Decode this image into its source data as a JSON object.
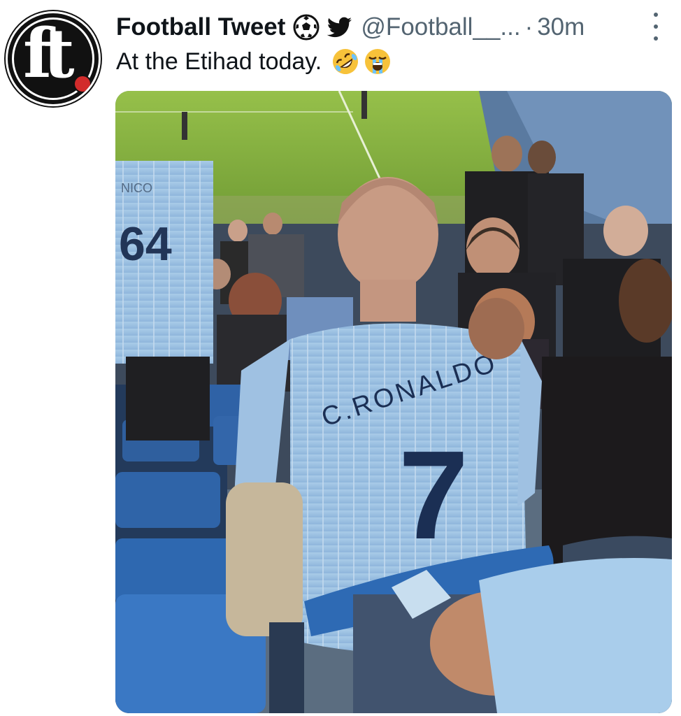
{
  "tweet": {
    "avatar_text": "ft",
    "author_name": "Football Tweet",
    "handle": "@Football__...",
    "separator": "·",
    "time": "30m",
    "text": "At the Etihad today.",
    "text_emojis": [
      "rolling-on-floor-laughing-emoji",
      "loudly-crying-emoji"
    ],
    "name_badges": [
      "soccer-ball-icon",
      "twitter-bird-icon"
    ]
  },
  "photo": {
    "jersey_main_name": "C.RONALDO",
    "jersey_main_number": "7",
    "jersey_left_name": "NICO",
    "jersey_left_number": "64"
  },
  "colors": {
    "name": "#0f1419",
    "secondary": "#536471",
    "city_blue": "#9ec3e6",
    "pitch": "#7faa3a",
    "seat": "#2f5f9e"
  }
}
